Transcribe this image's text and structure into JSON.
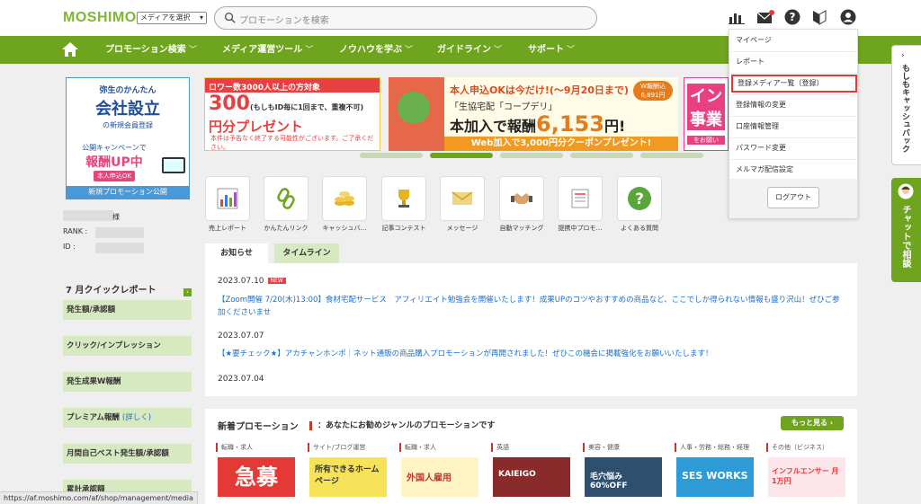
{
  "header": {
    "logo": "MOSHIMO",
    "media_select": "メディアを選択",
    "search_placeholder": "プロモーションを検索"
  },
  "nav": [
    "プロモーション検索",
    "メディア運営ツール",
    "ノウハウを学ぶ",
    "ガイドライン",
    "サポート"
  ],
  "sidebar_banner": {
    "line1": "弥生のかんたん",
    "line2": "会社設立",
    "line3": "の新規会員登録",
    "line4": "公開キャンペーンで",
    "line5": "報酬UP中",
    "line6": "本人申込OK",
    "footer": "新規プロモーション公開"
  },
  "profile": {
    "suffix": "様",
    "rank_label": "RANK :",
    "id_label": "ID :"
  },
  "quick_report": {
    "title": "7 月クイックレポート",
    "rows": [
      "発生額/承認額",
      "クリック/インプレッション",
      "発生成果W報酬",
      "プレミアム報酬",
      "月間自己ベスト発生額/承認額",
      "累計承認額"
    ],
    "detail_link": "(詳しく)"
  },
  "banners": {
    "b1_top": "ロワー数3000人以上の方対象",
    "b1_mid": "300",
    "b1_mid_small": "(もしもID毎に1回まで、重複不可)",
    "b1_mid_rest": "円分プレゼント",
    "b1_bottom": "本件は予告なく終了する可能性がございます。ご了承ください。",
    "b2_t1": "本人申込OKは今だけ!(～9月20日まで)",
    "b2_t2": "「生協宅配「コープデリ」",
    "b2_t3": "本加入で報酬",
    "b2_number": "6,153",
    "b2_yen": "円!",
    "b2_badge": "W報酬込 6,891円",
    "b2_bar": "Web加入で3,000円分クーポンプレゼント!",
    "b3_main": "イン事業",
    "b3_sub": "をお願い"
  },
  "menu_icons": [
    "売上レポート",
    "かんたんリンク",
    "キャッシュバ…",
    "記事コンテスト",
    "メッセージ",
    "自動マッチング",
    "提携中プロモ…",
    "よくある質問"
  ],
  "tabs": {
    "news": "お知らせ",
    "timeline": "タイムライン"
  },
  "news": [
    {
      "date": "2023.07.10",
      "badge": "NEW",
      "text": "【Zoom開催 7/20(木)13:00】食材宅配サービス　アフィリエイト勉強会を開催いたします！成果UPのコツやおすすめの商品など、ここでしか得られない情報も盛り沢山！ぜひご参加くださいませ"
    },
    {
      "date": "2023.07.07",
      "text": "【★要チェック★】アカチャンホンポ｜ネット通販の商品購入プロモーションが再開されました！ぜひこの機会に掲載強化をお願いいたします！"
    },
    {
      "date": "2023.07.04",
      "text": ""
    }
  ],
  "promo": {
    "title": "新着プロモーション",
    "subtitle": "：あなたにお勧めジャンルのプロモーションです",
    "more": "もっと見る",
    "categories": [
      "転職・求人",
      "サイト/ブログ運営",
      "転職・求人",
      "英語",
      "美容・健康",
      "人事・労務・総務・経理",
      "その他（ビジネス）"
    ],
    "tiles": [
      "急募",
      "所有できるホームページ",
      "外国人雇用",
      "KAIEIGO",
      "毛穴悩み 60%OFF",
      "SES WORKS",
      "インフルエンサー 月1万円"
    ]
  },
  "dropdown": [
    "マイページ",
    "レポート",
    "登録メディア一覧（登録）",
    "登録情報の変更",
    "口座情報管理",
    "パスワード変更",
    "メルマガ配信設定"
  ],
  "logout": "ログアウト",
  "side_tabs": {
    "cashback": "もしもキャッシュバック",
    "chat": "チャットで相談"
  },
  "status_url": "https://af.moshimo.com/af/shop/management/media",
  "colors": {
    "brand_green": "#6fa41f",
    "link_blue": "#1a6fd1",
    "highlight_red": "#e53935"
  }
}
